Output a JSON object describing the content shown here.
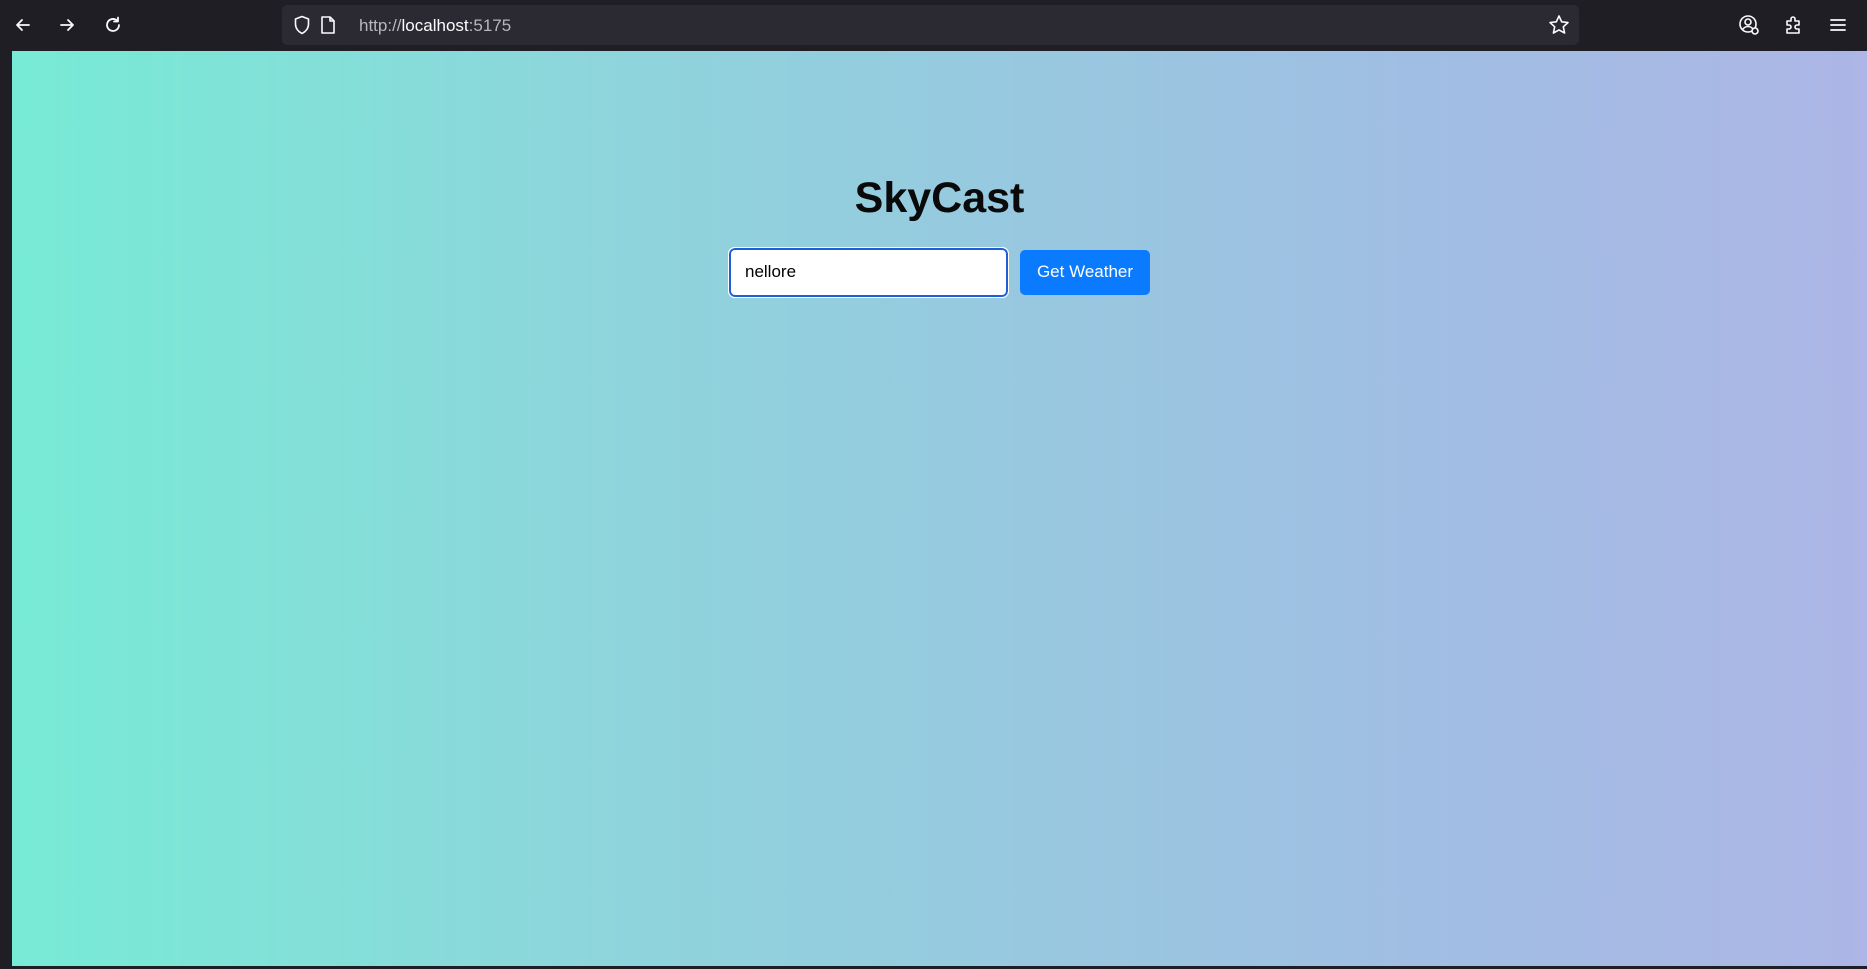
{
  "browser": {
    "url_scheme": "http://",
    "url_host": "localhost",
    "url_port": ":5175",
    "icons": {
      "back": "arrow-left-icon",
      "forward": "arrow-right-icon",
      "reload": "reload-icon",
      "shield": "shield-icon",
      "page": "page-icon",
      "bookmark": "star-icon",
      "account": "account-icon",
      "extensions": "puzzle-icon",
      "menu": "hamburger-menu-icon"
    }
  },
  "app": {
    "title": "SkyCast",
    "search": {
      "value": "nellore",
      "button_label": "Get Weather"
    },
    "colors": {
      "gradient_start": "#77ebd5",
      "gradient_end": "#adb6e6",
      "button": "#0a7bff",
      "input_border": "#1f5fd6"
    }
  }
}
